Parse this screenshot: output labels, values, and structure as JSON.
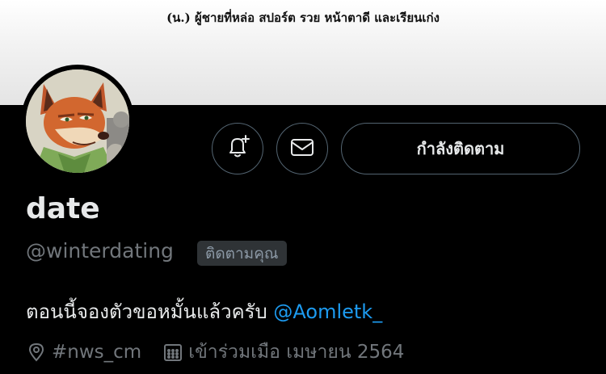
{
  "banner": {
    "text": "(น.) ผู้ชายที่หล่อ สปอร์ต รวย หน้าตาดี และเรียนเก่ง"
  },
  "profile": {
    "display_name": "date",
    "handle": "@winterdating",
    "follows_you_label": "ติดตามคุณ",
    "bio_text": "ตอนนี้จองตัวขอหมั้นแล้วครับ ",
    "bio_mention": "@Aomletk_",
    "location": "#nws_cm",
    "joined": "เข้าร่วมเมือ เมษายน 2564"
  },
  "actions": {
    "follow_label": "กำลังติดตาม"
  },
  "icons": {
    "notify": "bell-plus-icon",
    "message": "envelope-icon",
    "location": "map-pin-icon",
    "joined": "calendar-icon"
  },
  "colors": {
    "accent": "#1d9bf0",
    "background": "#000000",
    "muted": "#71767b"
  }
}
